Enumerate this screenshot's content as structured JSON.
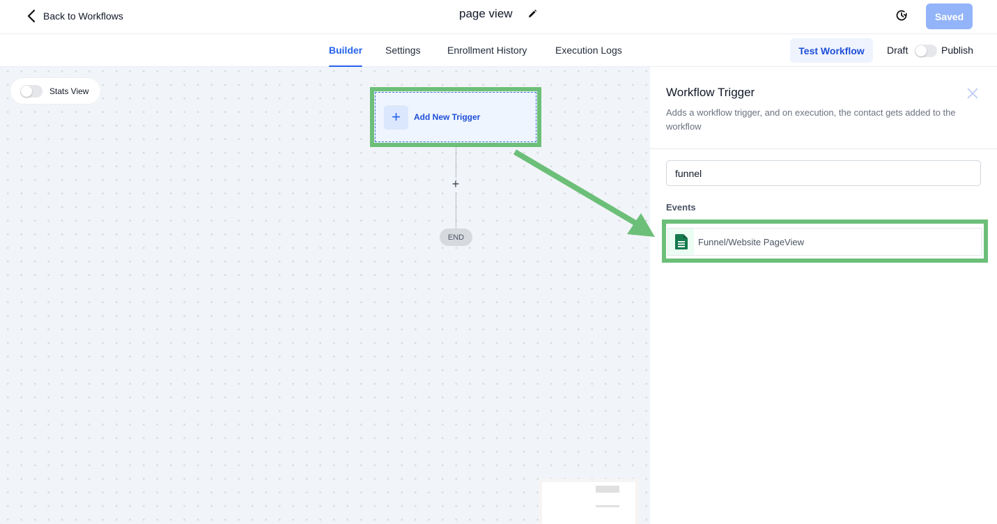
{
  "header": {
    "back_label": "Back to Workflows",
    "title": "page view",
    "saved_label": "Saved",
    "icons": {
      "back": "chevron-left-icon",
      "edit": "pencil-icon",
      "history": "history-clock-icon"
    }
  },
  "tabs": [
    {
      "label": "Builder",
      "active": true
    },
    {
      "label": "Settings",
      "active": false
    },
    {
      "label": "Enrollment History",
      "active": false
    },
    {
      "label": "Execution Logs",
      "active": false
    }
  ],
  "actions": {
    "test_workflow_label": "Test Workflow",
    "draft_label": "Draft",
    "publish_label": "Publish",
    "publish_toggle_on": false
  },
  "canvas": {
    "stats_view_label": "Stats View",
    "stats_view_on": false,
    "trigger_node_label": "Add New Trigger",
    "add_step_symbol": "+",
    "end_label": "END"
  },
  "panel": {
    "title": "Workflow Trigger",
    "description": "Adds a workflow trigger, and on execution, the contact gets added to the workflow",
    "search_value": "funnel",
    "section_label": "Events",
    "events": [
      {
        "label": "Funnel/Website PageView",
        "icon": "document-icon"
      }
    ]
  },
  "annotations": {
    "highlight_color": "#6cbf78"
  },
  "colors": {
    "accent": "#2563eb",
    "saved_button": "#93b4f8",
    "canvas_bg": "#f1f4f8"
  }
}
